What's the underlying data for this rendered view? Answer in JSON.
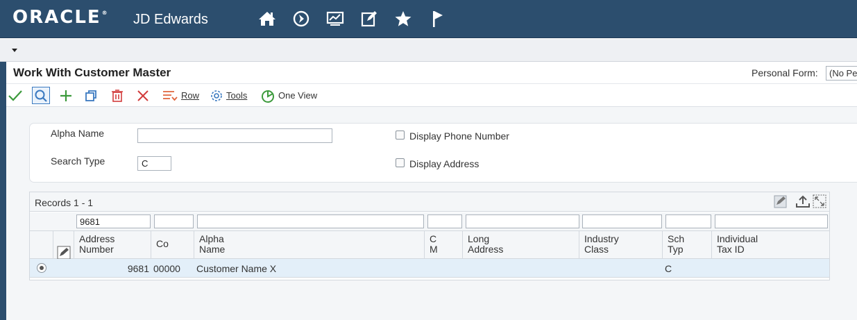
{
  "banner": {
    "logo": "ORACLE",
    "logo_mark": "®",
    "product": "JD Edwards",
    "icons": [
      "home-icon",
      "navigator-icon",
      "analytics-icon",
      "edit-icon",
      "favorites-icon",
      "flag-icon"
    ]
  },
  "page": {
    "title": "Work With Customer Master",
    "personal_form_label": "Personal Form:",
    "personal_form_value": "(No Pe"
  },
  "toolbar": {
    "row_label": "Row",
    "tools_label": "Tools",
    "oneview_label": "One View"
  },
  "search": {
    "alpha_name_label": "Alpha Name",
    "alpha_name_value": "",
    "search_type_label": "Search Type",
    "search_type_value": "C",
    "display_phone_label": "Display Phone Number",
    "display_address_label": "Display Address"
  },
  "grid": {
    "records_text": "Records 1 - 1",
    "qbe_address_number": "9681",
    "columns": {
      "address_number": "Address\nNumber",
      "co": "Co",
      "alpha_name": "Alpha\nName",
      "cm": "C\nM",
      "long_address": "Long\nAddress",
      "industry_class": "Industry\nClass",
      "sch_typ": "Sch\nTyp",
      "tax_id": "Individual\nTax ID"
    },
    "rows": [
      {
        "address_number": "9681",
        "co": "00000",
        "alpha_name": "Customer Name X",
        "cm": "",
        "long_address": "",
        "industry_class": "",
        "sch_typ": "C",
        "tax_id": ""
      }
    ]
  },
  "colors": {
    "banner": "#2c4e6e",
    "accent_blue": "#3a79c0",
    "ok_green": "#3c9a3c",
    "delete_red": "#d23c3c",
    "selected_row": "#e3eff9"
  }
}
